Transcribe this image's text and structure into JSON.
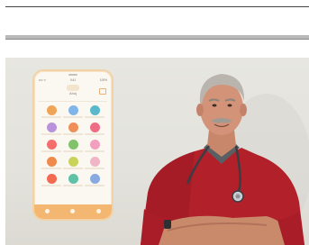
{
  "page": {
    "background": "#ffffff"
  },
  "photo": {
    "description_colors": {
      "wall": "#e5e4de",
      "shirt": "#b2202a",
      "phone_frame": "#f2d3a8"
    },
    "phone": {
      "status_left": "•••• ᯤ",
      "status_time": "9:41",
      "status_right": "100%",
      "app_title": "Ahoj",
      "app_subtitle": "",
      "icon_colors": [
        "#f0a456",
        "#7fb5e8",
        "#59b8c9",
        "#b993d9",
        "#f08e5a",
        "#f06b84",
        "#f56e6e",
        "#82c26a",
        "#f3a0c0",
        "#f08a4b",
        "#c9d35a",
        "#f0b6c7",
        "#f26a4f",
        "#5fc1a6",
        "#8aa9e0"
      ],
      "tabs": [
        {
          "icon": "home-icon",
          "label": ""
        },
        {
          "icon": "calendar-icon",
          "label": ""
        },
        {
          "icon": "profile-icon",
          "label": ""
        }
      ]
    }
  }
}
